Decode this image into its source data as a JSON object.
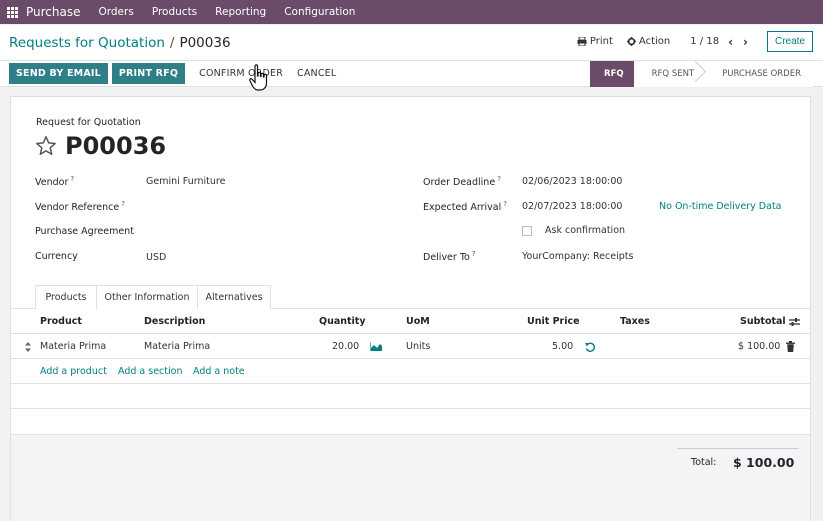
{
  "nav": {
    "app_name": "Purchase",
    "menu": [
      "Orders",
      "Products",
      "Reporting",
      "Configuration"
    ]
  },
  "control": {
    "breadcrumb_parent": "Requests for Quotation",
    "breadcrumb_sep": "/",
    "breadcrumb_current": "P00036",
    "print_label": "Print",
    "action_label": "Action",
    "pager": "1 / 18",
    "create_label": "Create"
  },
  "actions": {
    "send_email": "SEND BY EMAIL",
    "print_rfq": "PRINT RFQ",
    "confirm_order": "CONFIRM ORDER",
    "cancel": "CANCEL"
  },
  "status": {
    "stages": [
      "RFQ",
      "RFQ SENT",
      "PURCHASE ORDER"
    ],
    "active": "RFQ"
  },
  "form": {
    "doc_type": "Request for Quotation",
    "name": "P00036",
    "vendor_label": "Vendor",
    "vendor_value": "Gemini Furniture",
    "vendor_ref_label": "Vendor Reference",
    "agreement_label": "Purchase Agreement",
    "currency_label": "Currency",
    "currency_value": "USD",
    "deadline_label": "Order Deadline",
    "deadline_value": "02/06/2023 18:00:00",
    "arrival_label": "Expected Arrival",
    "arrival_value": "02/07/2023 18:00:00",
    "ontime_link": "No On-time Delivery Data",
    "ask_confirmation": "Ask confirmation",
    "deliver_label": "Deliver To",
    "deliver_value": "YourCompany: Receipts",
    "help_mark": "?"
  },
  "tabs": [
    "Products",
    "Other Information",
    "Alternatives"
  ],
  "table": {
    "headers": {
      "product": "Product",
      "description": "Description",
      "quantity": "Quantity",
      "uom": "UoM",
      "unit_price": "Unit Price",
      "taxes": "Taxes",
      "subtotal": "Subtotal"
    },
    "rows": [
      {
        "product": "Materia Prima",
        "description": "Materia Prima",
        "quantity": "20.00",
        "uom": "Units",
        "unit_price": "5.00",
        "taxes": "",
        "subtotal": "$ 100.00"
      }
    ],
    "add_links": [
      "Add a product",
      "Add a section",
      "Add a note"
    ]
  },
  "totals": {
    "label": "Total:",
    "value": "$ 100.00"
  },
  "colors": {
    "brand": "#6b4c68",
    "primary_button": "#2e7f87",
    "link": "#017e84"
  }
}
